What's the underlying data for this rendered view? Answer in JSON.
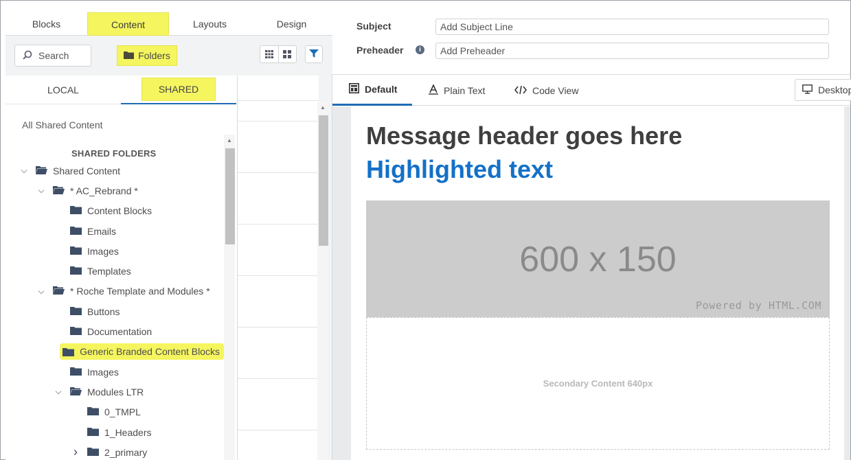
{
  "left_tabs": [
    "Blocks",
    "Content",
    "Layouts",
    "Design"
  ],
  "toolbar": {
    "search_label": "Search",
    "folders_label": "Folders"
  },
  "popup": {
    "tabs": [
      "LOCAL",
      "SHARED"
    ],
    "all_shared": "All Shared Content",
    "section_title": "SHARED FOLDERS",
    "tree": [
      {
        "label": "Shared Content",
        "level": 0,
        "expanded": true
      },
      {
        "label": "* AC_Rebrand *",
        "level": 1,
        "expanded": true
      },
      {
        "label": "Content Blocks",
        "level": 2
      },
      {
        "label": "Emails",
        "level": 2
      },
      {
        "label": "Images",
        "level": 2
      },
      {
        "label": "Templates",
        "level": 2
      },
      {
        "label": "* Roche Template and Modules *",
        "level": 1,
        "expanded": true
      },
      {
        "label": "Buttons",
        "level": 2
      },
      {
        "label": "Documentation",
        "level": 2
      },
      {
        "label": "Generic Branded Content Blocks",
        "level": 2,
        "highlight": true
      },
      {
        "label": "Images",
        "level": 2
      },
      {
        "label": "Modules LTR",
        "level": 2,
        "expanded": true
      },
      {
        "label": "0_TMPL",
        "level": 3
      },
      {
        "label": "1_Headers",
        "level": 3
      },
      {
        "label": "2_primary",
        "level": 3,
        "collapsed": true
      }
    ]
  },
  "fields": {
    "subject_label": "Subject",
    "subject_placeholder": "Add Subject Line",
    "preheader_label": "Preheader",
    "preheader_placeholder": "Add Preheader"
  },
  "view_tabs": {
    "default": "Default",
    "plain_text": "Plain Text",
    "code_view": "Code View",
    "device": "Desktop"
  },
  "email": {
    "header": "Message header goes here",
    "highlight": "Highlighted text",
    "hero_size": "600 x 150",
    "hero_powered": "Powered by HTML.COM",
    "secondary": "Secondary Content 640px"
  },
  "colors": {
    "highlight": "#f5f560",
    "accent_blue": "#1470c8",
    "folder_icon": "#3d4e66"
  }
}
